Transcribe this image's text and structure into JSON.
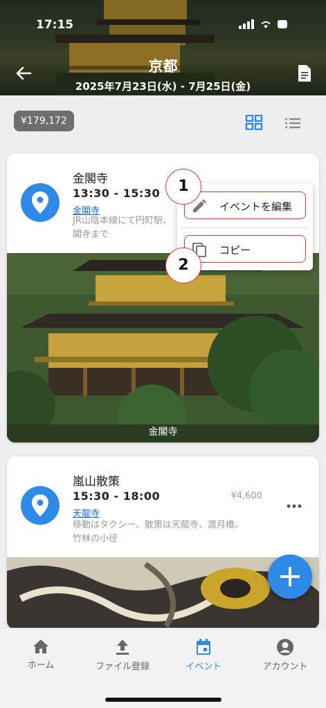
{
  "status_bar": {
    "time": "17:15"
  },
  "header": {
    "title": "京都",
    "dates": "2025年7月23日(水) - 7月25日(金)",
    "back_icon": "arrow-left-icon",
    "doc_icon": "document-icon"
  },
  "toolbar": {
    "budget": "¥179,172",
    "views": [
      "grid-view-icon",
      "list-view-icon"
    ],
    "accent": "#2f89e6"
  },
  "events": [
    {
      "name": "金閣寺",
      "time": "13:30 - 15:30",
      "place": "金閣寺",
      "note": "JR山陰本線にて円町駅、\n閣寺まで",
      "price": "",
      "photo_caption": "金閣寺"
    },
    {
      "name": "嵐山散策",
      "time": "15:30 - 18:00",
      "place": "天龍寺",
      "note": "移動はタクシー、散策は天龍寺、渡月橋、竹林の小径",
      "price": "¥4,600",
      "photo_caption": ""
    }
  ],
  "context_menu": {
    "items": [
      {
        "label": "イベントを編集",
        "icon": "pencil-icon"
      },
      {
        "label": "コピー",
        "icon": "copy-icon"
      }
    ],
    "callouts": [
      "1",
      "2"
    ],
    "highlight": "#e03a3a"
  },
  "fab": {
    "icon": "plus-icon"
  },
  "bottom_nav": {
    "items": [
      {
        "label": "ホーム",
        "icon": "home-icon"
      },
      {
        "label": "ファイル登録",
        "icon": "upload-icon"
      },
      {
        "label": "イベント",
        "icon": "calendar-icon",
        "active": true
      },
      {
        "label": "アカウント",
        "icon": "account-icon"
      }
    ]
  }
}
